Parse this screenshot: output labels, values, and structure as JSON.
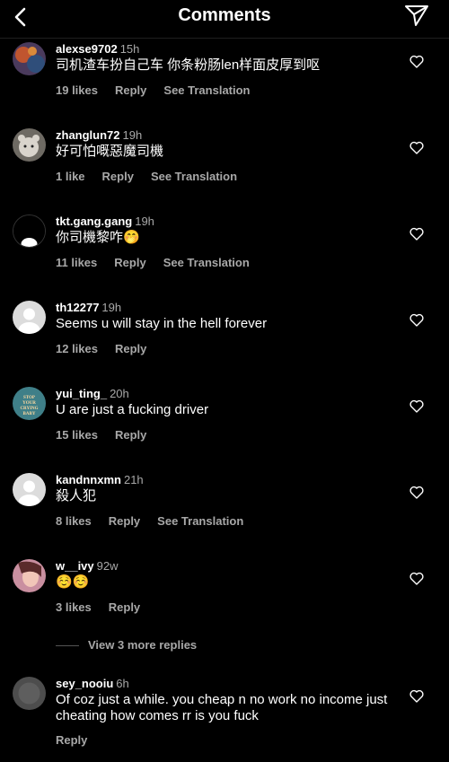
{
  "header": {
    "title": "Comments"
  },
  "comments": [
    {
      "user": "alexse9702",
      "time": "15h",
      "text": "司机渣车扮自己车 你条粉肠len样面皮厚到呕",
      "likes": "19 likes",
      "reply": "Reply",
      "translate": "See Translation"
    },
    {
      "user": "zhanglun72",
      "time": "19h",
      "text": "好可怕嘅惡魔司機",
      "likes": "1 like",
      "reply": "Reply",
      "translate": "See Translation"
    },
    {
      "user": "tkt.gang.gang",
      "time": "19h",
      "text": "你司機黎咋🤭",
      "likes": "11 likes",
      "reply": "Reply",
      "translate": "See Translation"
    },
    {
      "user": "th12277",
      "time": "19h",
      "text": "Seems u will stay in the hell forever",
      "likes": "12 likes",
      "reply": "Reply"
    },
    {
      "user": "yui_ting_",
      "time": "20h",
      "text": "U are just a fucking driver",
      "likes": "15 likes",
      "reply": "Reply",
      "avatar_text": "STOP YOUR CRYING BABY"
    },
    {
      "user": "kandnnxmn",
      "time": "21h",
      "text": "殺人犯",
      "likes": "8 likes",
      "reply": "Reply",
      "translate": "See Translation"
    },
    {
      "user": "w__ivy",
      "time": "92w",
      "text": "☺️☺️",
      "likes": "3 likes",
      "reply": "Reply"
    },
    {
      "user": "sey_nooiu",
      "time": "6h",
      "text": "Of coz just a while. you cheap n no work no income just cheating how comes rr is you fuck",
      "reply": "Reply"
    }
  ],
  "view_more": "View 3 more replies",
  "colors": {
    "background": "#000000",
    "secondary_text": "#a8a8a8"
  },
  "icons": [
    "back-arrow-icon",
    "send-icon",
    "heart-outline-icon"
  ]
}
